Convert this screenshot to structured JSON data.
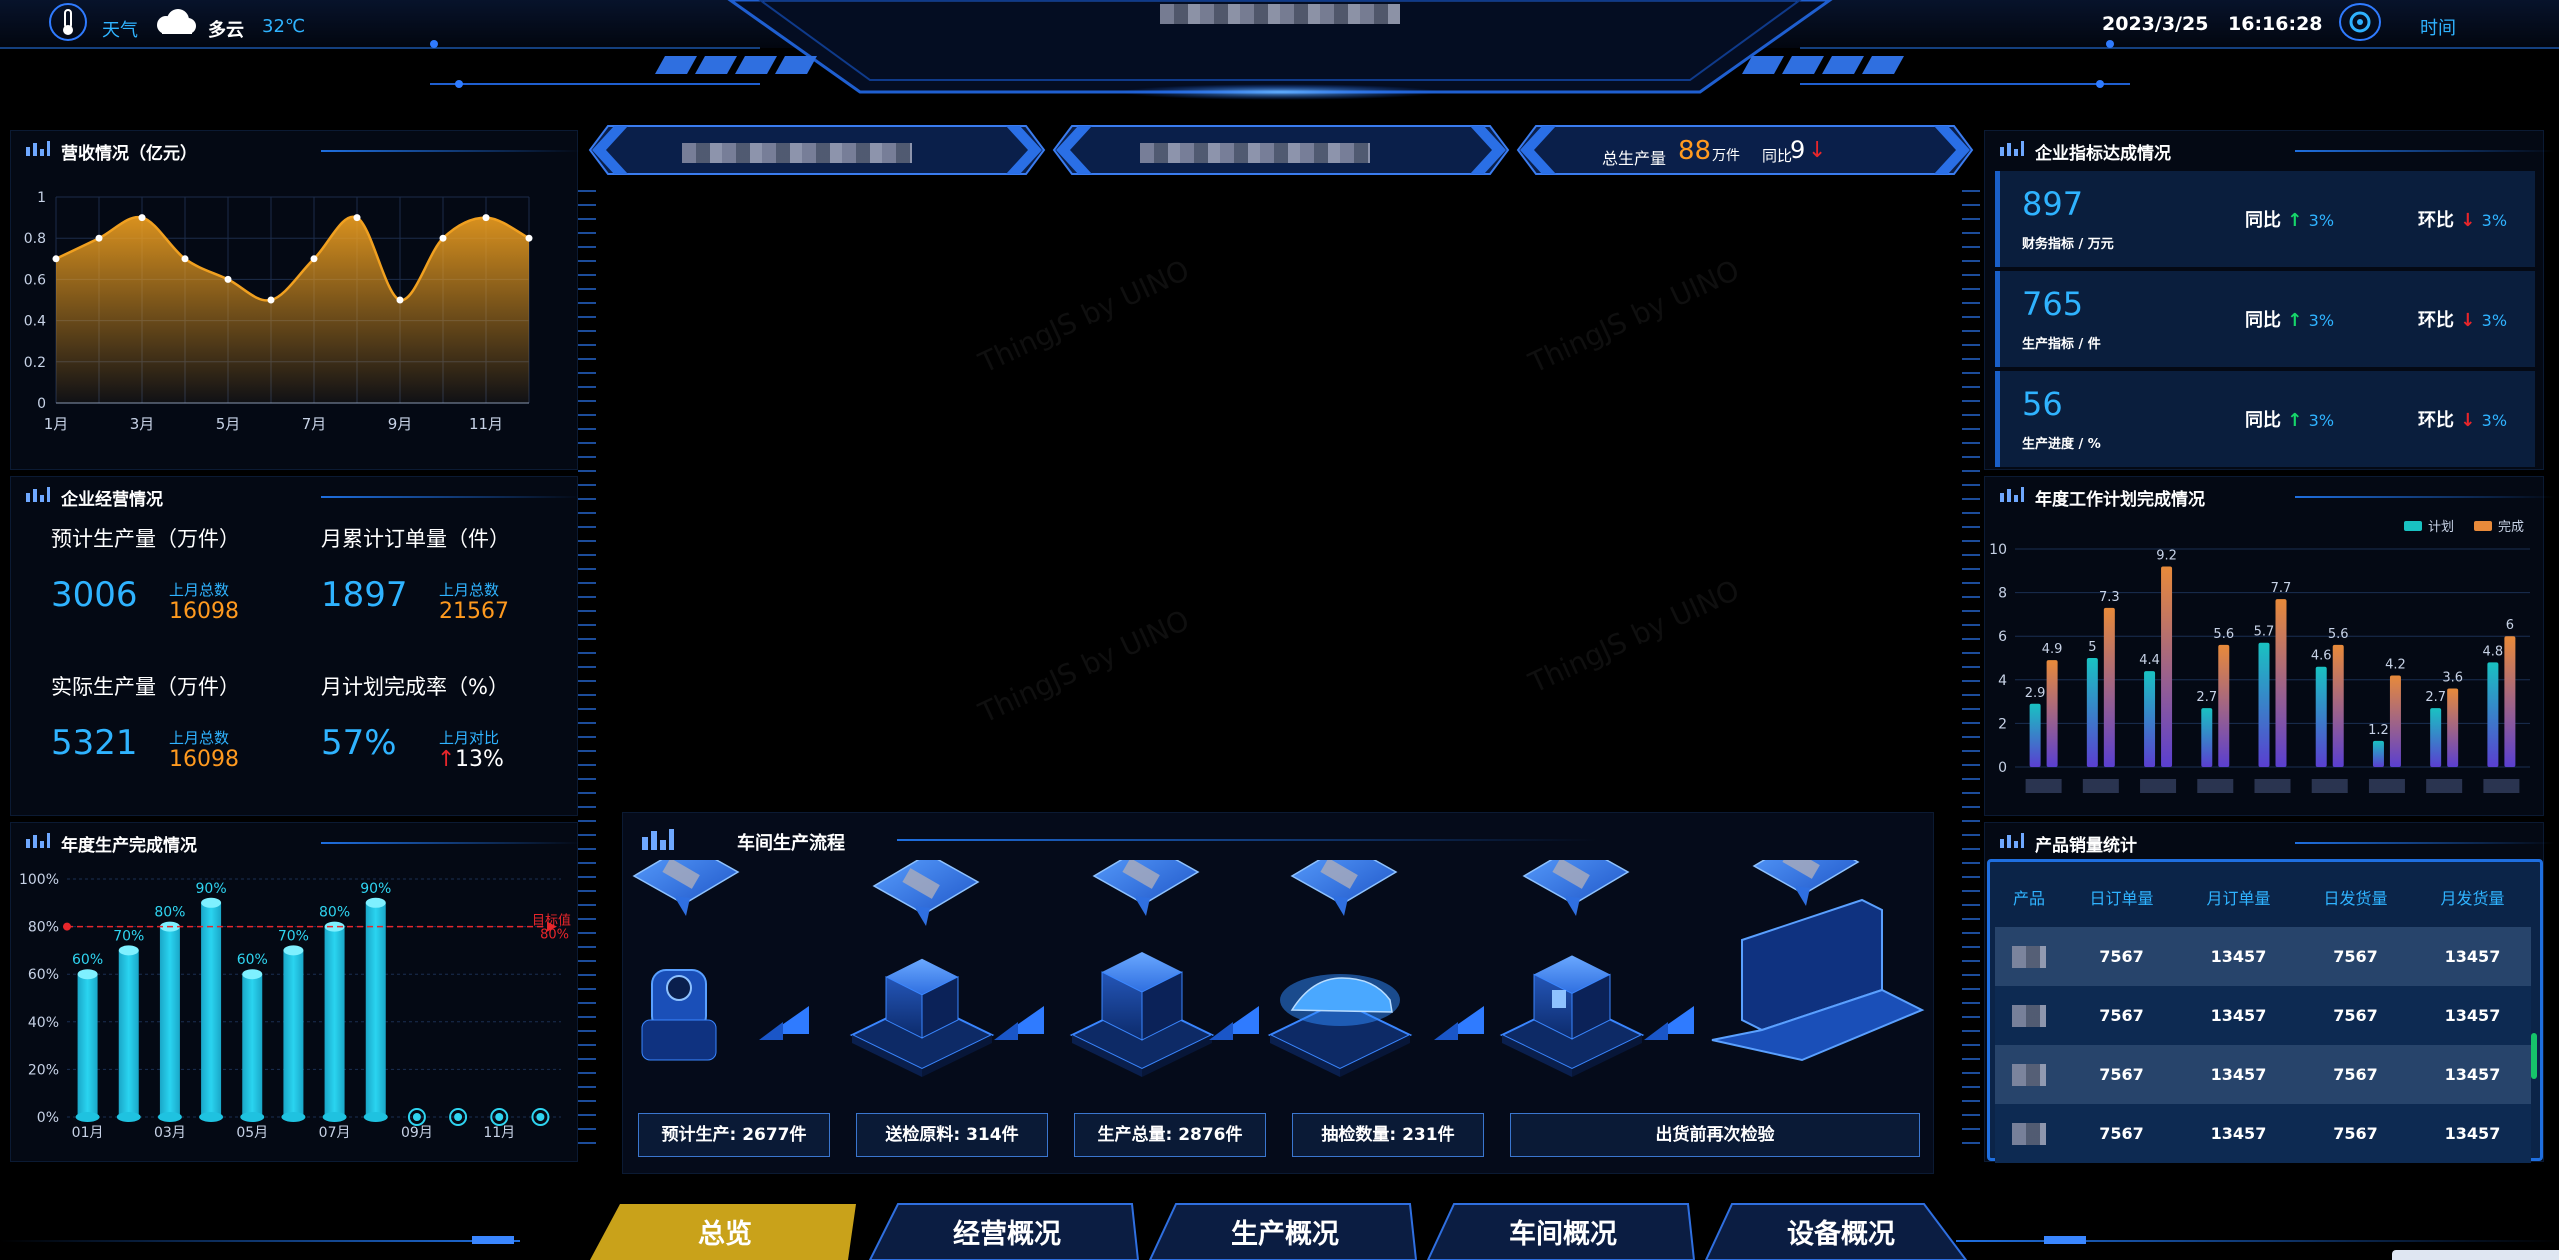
{
  "header": {
    "weather_label": "天气",
    "weather_condition": "多云",
    "temperature": "32℃",
    "date": "2023/3/25",
    "time": "16:16:28",
    "time_label": "时间"
  },
  "banners": [
    {
      "text": ""
    },
    {
      "text": ""
    },
    {
      "label": "总生产量",
      "value": "88",
      "unit": "万件",
      "yoy_label": "同比",
      "yoy_value": "9"
    }
  ],
  "revenue": {
    "title": "营收情况（亿元）",
    "chart_data": {
      "type": "area",
      "x": [
        "1月",
        "2月",
        "3月",
        "4月",
        "5月",
        "6月",
        "7月",
        "8月",
        "9月",
        "10月",
        "11月",
        "12月"
      ],
      "tick_labels": [
        "1月",
        "3月",
        "5月",
        "7月",
        "9月",
        "11月"
      ],
      "values": [
        0.7,
        0.8,
        0.9,
        0.7,
        0.6,
        0.5,
        0.7,
        0.9,
        0.5,
        0.8,
        0.9,
        0.8
      ],
      "ylim": [
        0,
        1
      ],
      "y_ticks": [
        "0",
        "0.2",
        "0.4",
        "0.6",
        "0.8",
        "1"
      ],
      "color": "#f0a020"
    }
  },
  "business": {
    "title": "企业经营情况",
    "items": [
      {
        "label": "预计生产量（万件）",
        "value": "3006",
        "sub_label": "上月总数",
        "sub_value": "16098"
      },
      {
        "label": "月累计订单量（件）",
        "value": "1897",
        "sub_label": "上月总数",
        "sub_value": "21567"
      },
      {
        "label": "实际生产量（万件）",
        "value": "5321",
        "sub_label": "上月总数",
        "sub_value": "16098"
      },
      {
        "label": "月计划完成率（%）",
        "value": "57%",
        "sub_label": "上月对比",
        "sub_value": "13%"
      }
    ]
  },
  "annual_production": {
    "title": "年度生产完成情况",
    "chart_data": {
      "type": "bar",
      "categories": [
        "01月",
        "02月",
        "03月",
        "04月",
        "05月",
        "06月",
        "07月",
        "08月",
        "09月",
        "10月",
        "11月",
        "12月"
      ],
      "tick_labels": [
        "01月",
        "03月",
        "05月",
        "07月",
        "09月",
        "11月"
      ],
      "values": [
        60,
        70,
        80,
        90,
        60,
        70,
        80,
        90,
        0,
        0,
        0,
        0
      ],
      "value_labels": [
        "60%",
        "70%",
        "80%",
        "90%",
        "60%",
        "70%",
        "80%",
        "90%",
        "",
        "",
        "",
        ""
      ],
      "ylim": [
        0,
        100
      ],
      "y_ticks": [
        "0%",
        "20%",
        "40%",
        "60%",
        "80%",
        "100%"
      ],
      "target_label": "目标值",
      "target_value": 80,
      "target_value_label": "80%",
      "color": "#2ad4f0"
    }
  },
  "workshop_flow": {
    "title": "车间生产流程",
    "steps": [
      "预计生产: 2677件",
      "送检原料: 314件",
      "生产总量: 2876件",
      "抽检数量: 231件",
      "出货前再次检验"
    ]
  },
  "kpi": {
    "title": "企业指标达成情况",
    "cards": [
      {
        "value": "897",
        "label": "财务指标 / 万元",
        "yoy_label": "同比",
        "yoy": "3%",
        "mom_label": "环比",
        "mom": "3%"
      },
      {
        "value": "765",
        "label": "生产指标 / 件",
        "yoy_label": "同比",
        "yoy": "3%",
        "mom_label": "环比",
        "mom": "3%"
      },
      {
        "value": "56",
        "label": "生产进度 / %",
        "yoy_label": "同比",
        "yoy": "3%",
        "mom_label": "环比",
        "mom": "3%"
      }
    ]
  },
  "work_plan": {
    "title": "年度工作计划完成情况",
    "chart_data": {
      "type": "bar",
      "categories": [
        "",
        "",
        "",
        "",
        "",
        "",
        "",
        "",
        ""
      ],
      "series": [
        {
          "name": "计划",
          "values": [
            2.9,
            5,
            4.4,
            2.7,
            5.7,
            4.6,
            1.2,
            2.7,
            4.8
          ],
          "color": "#19c2c2"
        },
        {
          "name": "完成",
          "values": [
            4.9,
            7.3,
            9.2,
            5.6,
            7.7,
            5.6,
            4.2,
            3.6,
            6
          ],
          "color": "#e88a3a"
        }
      ],
      "ylim": [
        0,
        10
      ],
      "y_ticks": [
        "0",
        "2",
        "4",
        "6",
        "8",
        "10"
      ],
      "legend": "top-right"
    }
  },
  "sales": {
    "title": "产品销量统计",
    "columns": [
      "产品",
      "日订单量",
      "月订单量",
      "日发货量",
      "月发货量"
    ],
    "rows": [
      [
        "",
        "7567",
        "13457",
        "7567",
        "13457"
      ],
      [
        "",
        "7567",
        "13457",
        "7567",
        "13457"
      ],
      [
        "",
        "7567",
        "13457",
        "7567",
        "13457"
      ],
      [
        "",
        "7567",
        "13457",
        "7567",
        "13457"
      ]
    ]
  },
  "nav_tabs": [
    "总览",
    "经营概况",
    "生产概况",
    "车间概况",
    "设备概况"
  ],
  "watermark": "ThingJS by UINO",
  "colors": {
    "accent": "#2fb3ff",
    "orange": "#ff9a1f",
    "up": "#16d66a",
    "down": "#e8262b",
    "tab_active": "#c9a21a"
  }
}
